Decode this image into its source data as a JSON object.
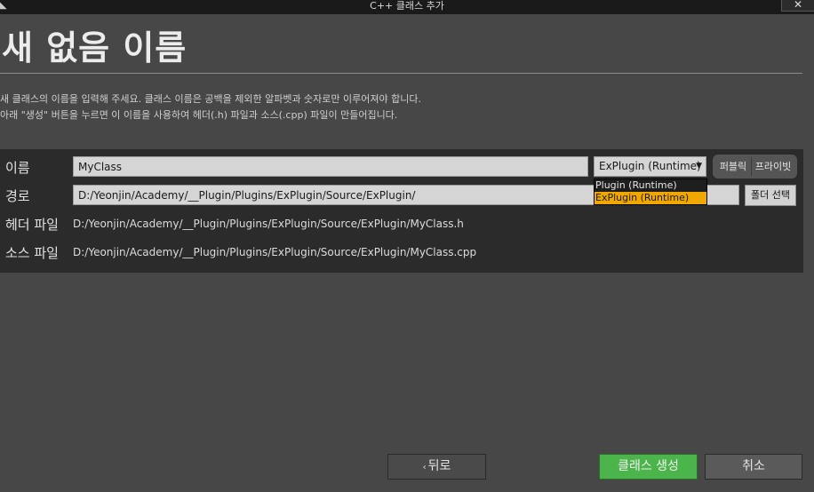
{
  "window": {
    "title": "C++ 클래스 추가",
    "close_label": "✕"
  },
  "heading": "새 없음 이름",
  "description": {
    "line1": "새 클래스의 이름을 입력해 주세요. 클래스 이름은 공백을 제외한 알파벳과 숫자로만 이루어져야 합니다.",
    "line2": "아래 \"생성\" 버튼을 누르면 이 이름을 사용하여 헤더(.h) 파일과 소스(.cpp) 파일이 만들어집니다."
  },
  "form": {
    "name_label": "이름",
    "name_value": "MyClass",
    "path_label": "경로",
    "path_value": "D:/Yeonjin/Academy/__Plugin/Plugins/ExPlugin/Source/ExPlugin/",
    "header_label": "헤더 파일",
    "header_value": "D:/Yeonjin/Academy/__Plugin/Plugins/ExPlugin/Source/ExPlugin/MyClass.h",
    "source_label": "소스 파일",
    "source_value": "D:/Yeonjin/Academy/__Plugin/Plugins/ExPlugin/Source/ExPlugin/MyClass.cpp"
  },
  "module": {
    "selected": "ExPlugin (Runtime)",
    "options": [
      "Plugin (Runtime)",
      "ExPlugin (Runtime)"
    ]
  },
  "visibility": {
    "public_label": "퍼블릭",
    "private_label": "프라이빗"
  },
  "buttons": {
    "folder_select": "폴더 선택",
    "back": "뒤로",
    "create": "클래스 생성",
    "cancel": "취소"
  },
  "colors": {
    "create_button": "#4bb44b",
    "selected_option": "#f0a800",
    "panel_bg": "#2b2b2b"
  }
}
